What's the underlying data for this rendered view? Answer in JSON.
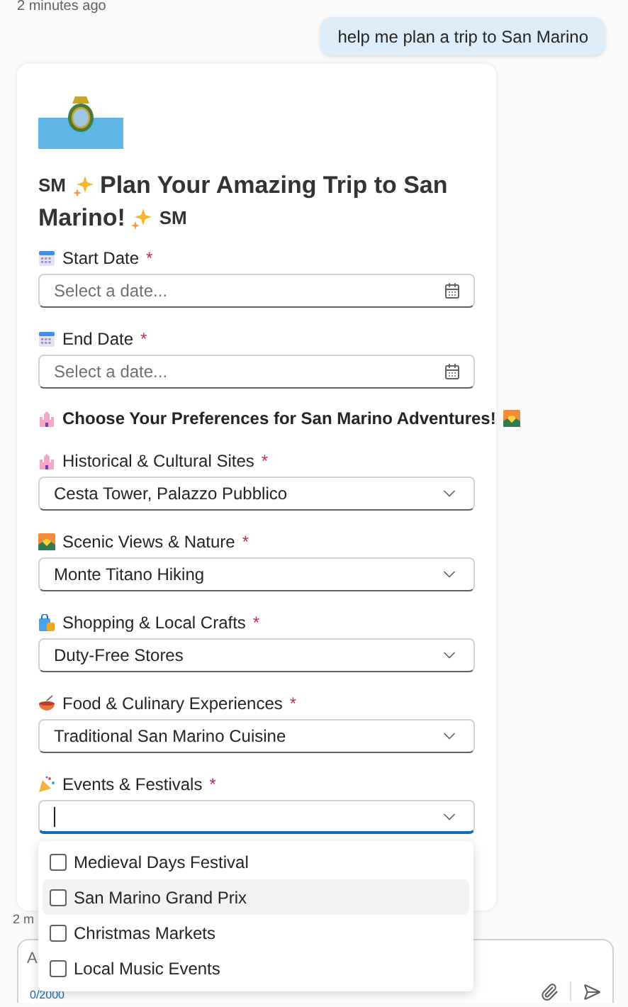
{
  "timestamp_top": "2 minutes ago",
  "user_message": "help me plan a trip to San Marino",
  "card": {
    "title": {
      "prefix": "SM",
      "line1": "Plan Your Amazing Trip to San",
      "line2": "Marino!",
      "suffix": "SM"
    },
    "fields": [
      {
        "kind": "date",
        "label": "Start Date",
        "required_mark": "*",
        "placeholder": "Select a date..."
      },
      {
        "kind": "date",
        "label": "End Date",
        "required_mark": "*",
        "placeholder": "Select a date..."
      },
      {
        "kind": "heading",
        "label": "Choose Your Preferences for San Marino Adventures!"
      },
      {
        "kind": "select",
        "label": "Historical & Cultural Sites",
        "required_mark": "*",
        "value": "Cesta Tower, Palazzo Pubblico"
      },
      {
        "kind": "select",
        "label": "Scenic Views & Nature",
        "required_mark": "*",
        "value": "Monte Titano Hiking"
      },
      {
        "kind": "select",
        "label": "Shopping & Local Crafts",
        "required_mark": "*",
        "value": "Duty-Free Stores"
      },
      {
        "kind": "select",
        "label": "Food & Culinary Experiences",
        "required_mark": "*",
        "value": "Traditional San Marino Cuisine"
      },
      {
        "kind": "combo",
        "label": "Events & Festivals",
        "required_mark": "*",
        "focused": true
      }
    ]
  },
  "dropdown": {
    "options": [
      {
        "label": "Medieval Days Festival",
        "checked": false,
        "selected": false
      },
      {
        "label": "San Marino Grand Prix",
        "checked": false,
        "selected": true
      },
      {
        "label": "Christmas Markets",
        "checked": false,
        "selected": false
      },
      {
        "label": "Local Music Events",
        "checked": false,
        "selected": false
      }
    ]
  },
  "timestamp_bottom": "2 m",
  "composer": {
    "placeholder": "A",
    "counter": "0/2000"
  }
}
